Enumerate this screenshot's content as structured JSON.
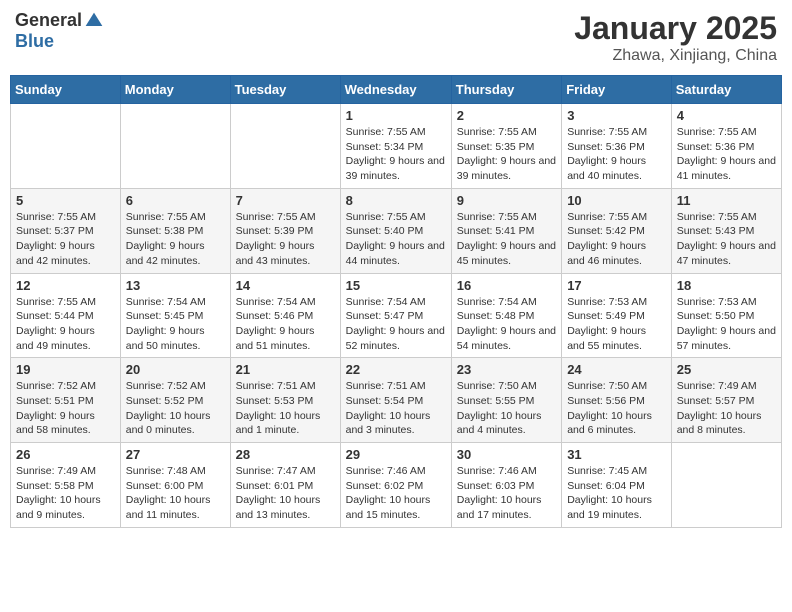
{
  "logo": {
    "general": "General",
    "blue": "Blue"
  },
  "title": "January 2025",
  "location": "Zhawa, Xinjiang, China",
  "days_of_week": [
    "Sunday",
    "Monday",
    "Tuesday",
    "Wednesday",
    "Thursday",
    "Friday",
    "Saturday"
  ],
  "weeks": [
    [
      {
        "num": "",
        "info": ""
      },
      {
        "num": "",
        "info": ""
      },
      {
        "num": "",
        "info": ""
      },
      {
        "num": "1",
        "info": "Sunrise: 7:55 AM\nSunset: 5:34 PM\nDaylight: 9 hours and 39 minutes."
      },
      {
        "num": "2",
        "info": "Sunrise: 7:55 AM\nSunset: 5:35 PM\nDaylight: 9 hours and 39 minutes."
      },
      {
        "num": "3",
        "info": "Sunrise: 7:55 AM\nSunset: 5:36 PM\nDaylight: 9 hours and 40 minutes."
      },
      {
        "num": "4",
        "info": "Sunrise: 7:55 AM\nSunset: 5:36 PM\nDaylight: 9 hours and 41 minutes."
      }
    ],
    [
      {
        "num": "5",
        "info": "Sunrise: 7:55 AM\nSunset: 5:37 PM\nDaylight: 9 hours and 42 minutes."
      },
      {
        "num": "6",
        "info": "Sunrise: 7:55 AM\nSunset: 5:38 PM\nDaylight: 9 hours and 42 minutes."
      },
      {
        "num": "7",
        "info": "Sunrise: 7:55 AM\nSunset: 5:39 PM\nDaylight: 9 hours and 43 minutes."
      },
      {
        "num": "8",
        "info": "Sunrise: 7:55 AM\nSunset: 5:40 PM\nDaylight: 9 hours and 44 minutes."
      },
      {
        "num": "9",
        "info": "Sunrise: 7:55 AM\nSunset: 5:41 PM\nDaylight: 9 hours and 45 minutes."
      },
      {
        "num": "10",
        "info": "Sunrise: 7:55 AM\nSunset: 5:42 PM\nDaylight: 9 hours and 46 minutes."
      },
      {
        "num": "11",
        "info": "Sunrise: 7:55 AM\nSunset: 5:43 PM\nDaylight: 9 hours and 47 minutes."
      }
    ],
    [
      {
        "num": "12",
        "info": "Sunrise: 7:55 AM\nSunset: 5:44 PM\nDaylight: 9 hours and 49 minutes."
      },
      {
        "num": "13",
        "info": "Sunrise: 7:54 AM\nSunset: 5:45 PM\nDaylight: 9 hours and 50 minutes."
      },
      {
        "num": "14",
        "info": "Sunrise: 7:54 AM\nSunset: 5:46 PM\nDaylight: 9 hours and 51 minutes."
      },
      {
        "num": "15",
        "info": "Sunrise: 7:54 AM\nSunset: 5:47 PM\nDaylight: 9 hours and 52 minutes."
      },
      {
        "num": "16",
        "info": "Sunrise: 7:54 AM\nSunset: 5:48 PM\nDaylight: 9 hours and 54 minutes."
      },
      {
        "num": "17",
        "info": "Sunrise: 7:53 AM\nSunset: 5:49 PM\nDaylight: 9 hours and 55 minutes."
      },
      {
        "num": "18",
        "info": "Sunrise: 7:53 AM\nSunset: 5:50 PM\nDaylight: 9 hours and 57 minutes."
      }
    ],
    [
      {
        "num": "19",
        "info": "Sunrise: 7:52 AM\nSunset: 5:51 PM\nDaylight: 9 hours and 58 minutes."
      },
      {
        "num": "20",
        "info": "Sunrise: 7:52 AM\nSunset: 5:52 PM\nDaylight: 10 hours and 0 minutes."
      },
      {
        "num": "21",
        "info": "Sunrise: 7:51 AM\nSunset: 5:53 PM\nDaylight: 10 hours and 1 minute."
      },
      {
        "num": "22",
        "info": "Sunrise: 7:51 AM\nSunset: 5:54 PM\nDaylight: 10 hours and 3 minutes."
      },
      {
        "num": "23",
        "info": "Sunrise: 7:50 AM\nSunset: 5:55 PM\nDaylight: 10 hours and 4 minutes."
      },
      {
        "num": "24",
        "info": "Sunrise: 7:50 AM\nSunset: 5:56 PM\nDaylight: 10 hours and 6 minutes."
      },
      {
        "num": "25",
        "info": "Sunrise: 7:49 AM\nSunset: 5:57 PM\nDaylight: 10 hours and 8 minutes."
      }
    ],
    [
      {
        "num": "26",
        "info": "Sunrise: 7:49 AM\nSunset: 5:58 PM\nDaylight: 10 hours and 9 minutes."
      },
      {
        "num": "27",
        "info": "Sunrise: 7:48 AM\nSunset: 6:00 PM\nDaylight: 10 hours and 11 minutes."
      },
      {
        "num": "28",
        "info": "Sunrise: 7:47 AM\nSunset: 6:01 PM\nDaylight: 10 hours and 13 minutes."
      },
      {
        "num": "29",
        "info": "Sunrise: 7:46 AM\nSunset: 6:02 PM\nDaylight: 10 hours and 15 minutes."
      },
      {
        "num": "30",
        "info": "Sunrise: 7:46 AM\nSunset: 6:03 PM\nDaylight: 10 hours and 17 minutes."
      },
      {
        "num": "31",
        "info": "Sunrise: 7:45 AM\nSunset: 6:04 PM\nDaylight: 10 hours and 19 minutes."
      },
      {
        "num": "",
        "info": ""
      }
    ]
  ]
}
